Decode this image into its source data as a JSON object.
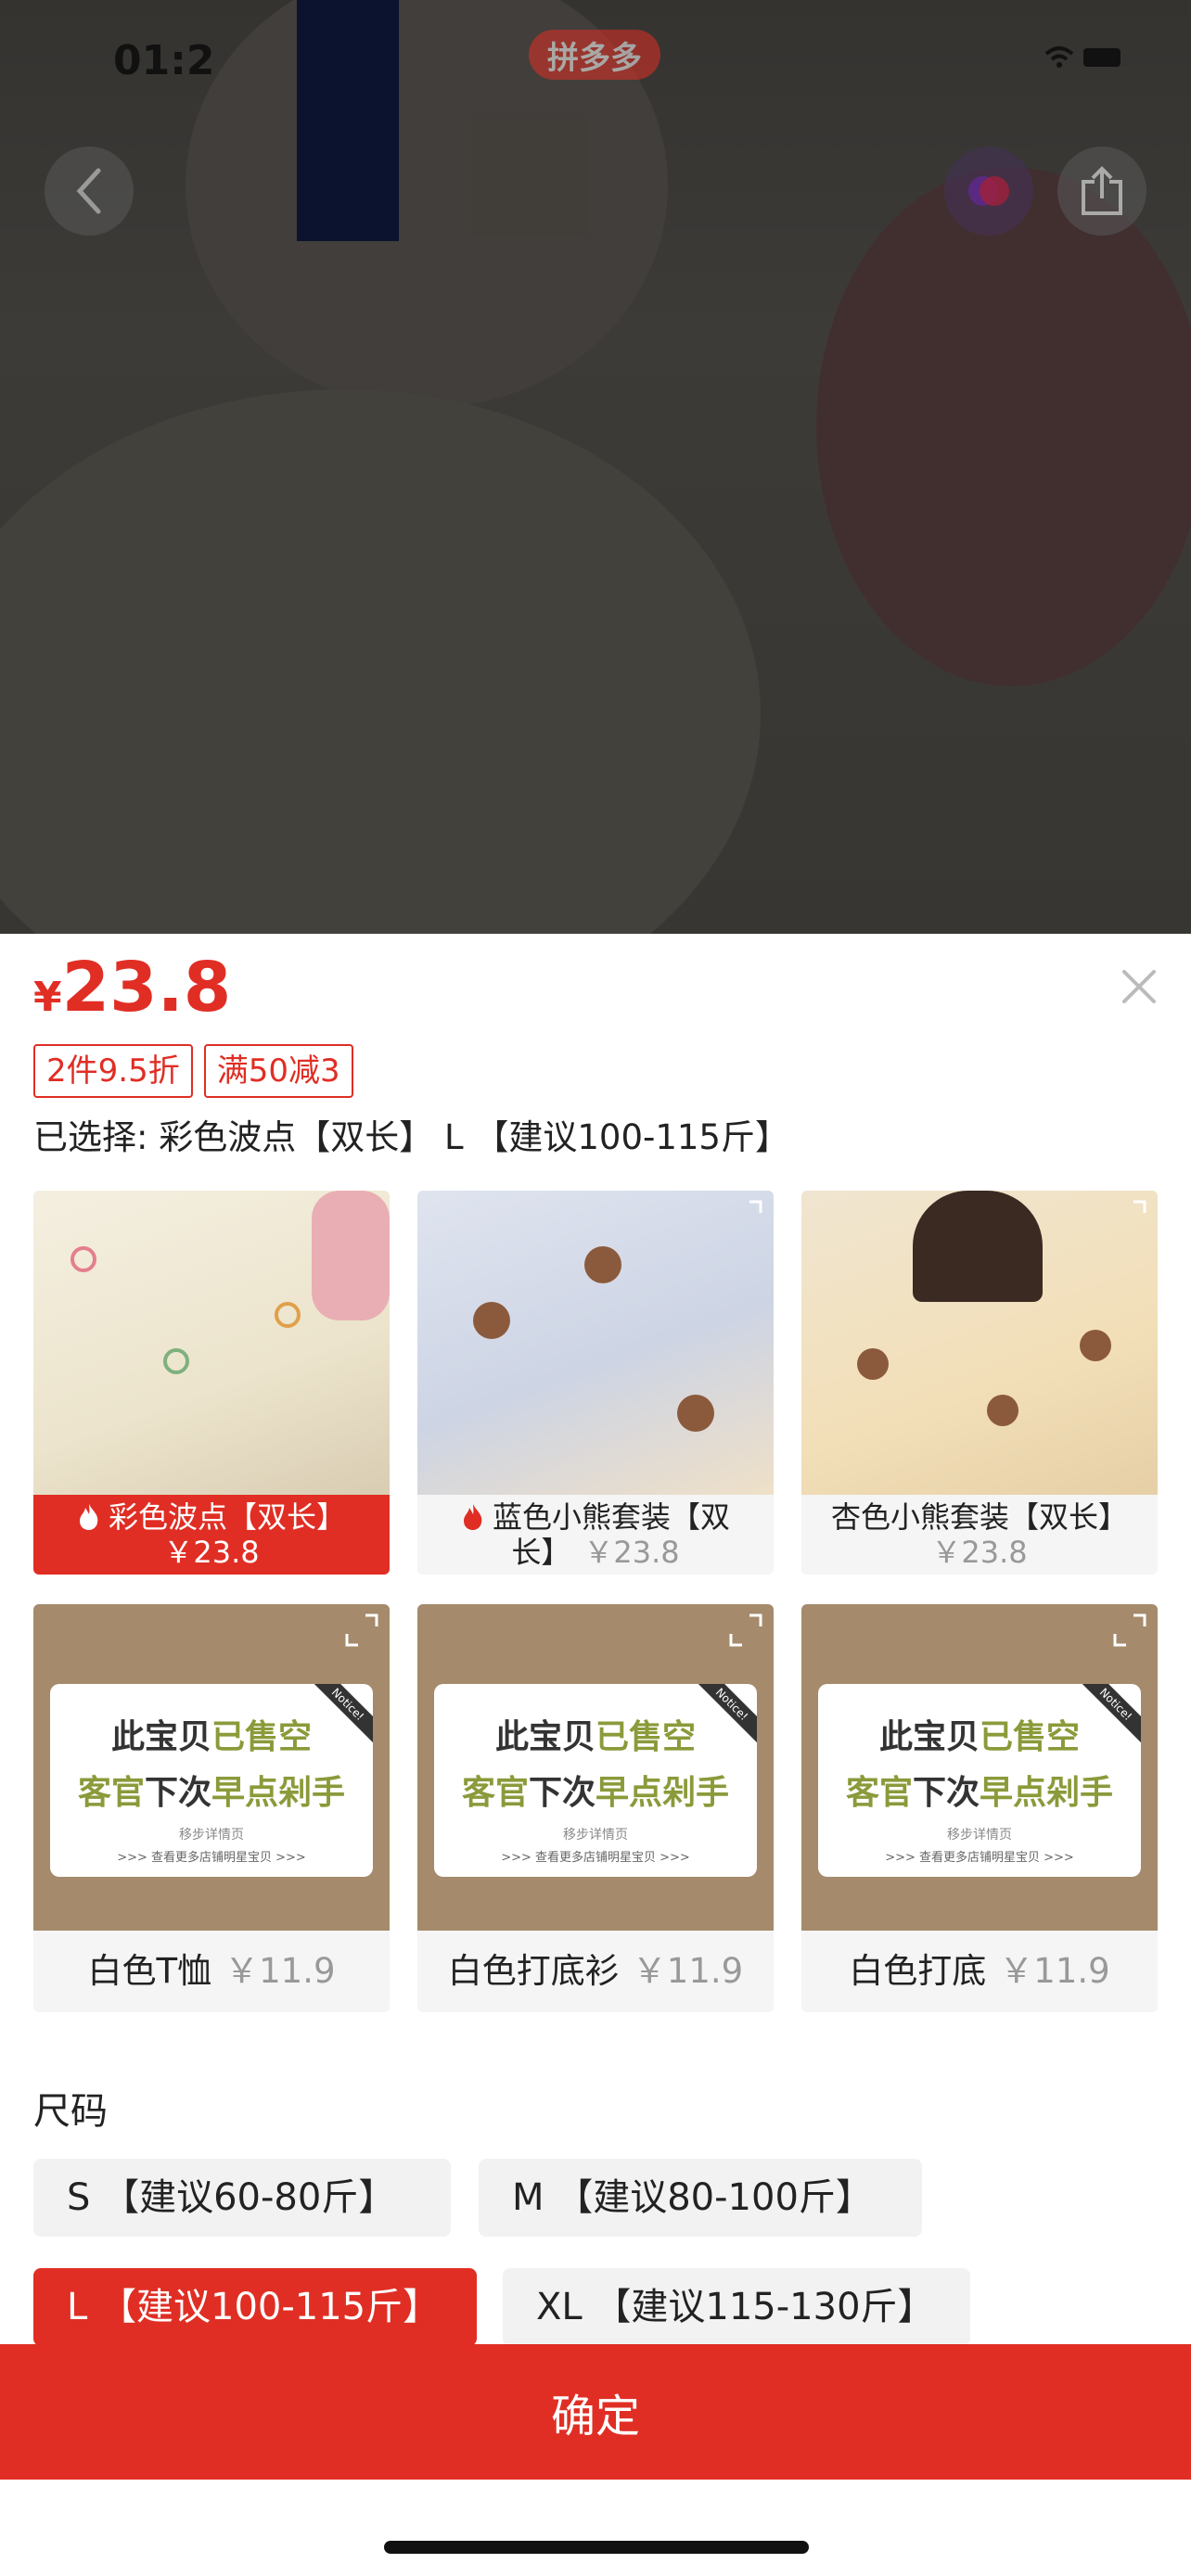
{
  "status_bar": {
    "time": "01:2",
    "brand_label": "拼多多"
  },
  "product": {
    "currency": "¥",
    "price": "23.8",
    "tags": [
      "2件9.5折",
      "满50减3"
    ],
    "selected_text": "已选择: 彩色波点【双长】 L 【建议100-115斤】"
  },
  "skus": [
    {
      "name": "彩色波点【双长】",
      "price": "￥23.8",
      "hot": true,
      "selected": true
    },
    {
      "name_line1": "蓝色小熊套装【双",
      "name_line2": "长】",
      "price": "￥23.8",
      "hot": true,
      "selected": false
    },
    {
      "name": "杏色小熊套装【双长】",
      "price": "￥23.8",
      "hot": false,
      "selected": false
    },
    {
      "name": "白色T恤",
      "price": "￥11.9",
      "sold_out": true
    },
    {
      "name": "白色打底衫",
      "price": "￥11.9",
      "sold_out": true
    },
    {
      "name": "白色打底",
      "price": "￥11.9",
      "sold_out": true
    }
  ],
  "sold_out_card": {
    "line1_a": "此宝贝",
    "line1_b": "已售空",
    "line2_a": "客官",
    "line2_b": "下次",
    "line2_c": "早点剁手",
    "line3": "移步详情页",
    "line4": ">>> 查看更多店铺明星宝贝 >>>",
    "ribbon": "Notice!"
  },
  "size_section": {
    "title": "尺码",
    "options": [
      {
        "label": "S 【建议60-80斤】",
        "selected": false
      },
      {
        "label": "M 【建议80-100斤】",
        "selected": false
      },
      {
        "label": "L 【建议100-115斤】",
        "selected": true
      },
      {
        "label": "XL 【建议115-130斤】",
        "selected": false
      }
    ]
  },
  "confirm_label": "确定",
  "colors": {
    "accent": "#e02e24",
    "chip_bg": "#f2f2f2"
  }
}
